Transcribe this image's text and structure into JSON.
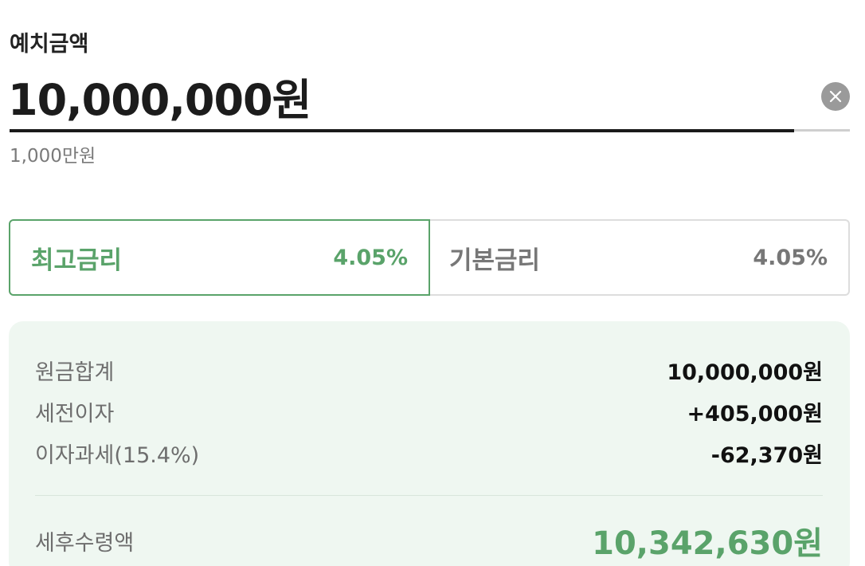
{
  "deposit": {
    "label": "예치금액",
    "value": "10,000,000원",
    "helper": "1,000만원",
    "clear_icon": "close-icon"
  },
  "rate_tabs": [
    {
      "label": "최고금리",
      "rate": "4.05%",
      "selected": true
    },
    {
      "label": "기본금리",
      "rate": "4.05%",
      "selected": false
    }
  ],
  "summary": {
    "rows": [
      {
        "label": "원금합계",
        "value": "10,000,000원"
      },
      {
        "label": "세전이자",
        "value": "+405,000원"
      },
      {
        "label": "이자과세(15.4%)",
        "value": "-62,370원"
      }
    ],
    "result": {
      "label": "세후수령액",
      "value": "10,342,630원"
    }
  },
  "colors": {
    "accent": "#5aa36a",
    "panel_bg": "#eff7f1",
    "text_primary": "#1a1a1a",
    "text_secondary": "#6e6e6e"
  }
}
